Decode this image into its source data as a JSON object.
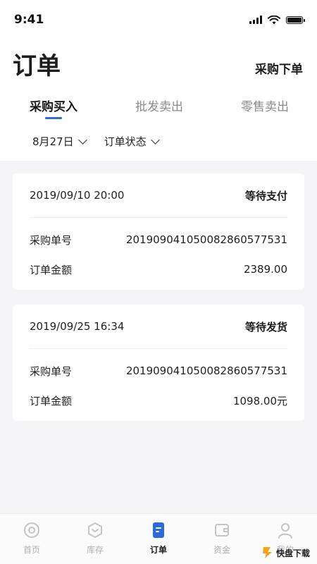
{
  "status_bar": {
    "time": "9:41"
  },
  "header": {
    "title": "订单",
    "action_label": "采购下单"
  },
  "tabs": [
    {
      "label": "采购买入",
      "active": true
    },
    {
      "label": "批发卖出",
      "active": false
    },
    {
      "label": "零售卖出",
      "active": false
    }
  ],
  "filters": {
    "date_label": "8月27日",
    "status_label": "订单状态"
  },
  "orders": [
    {
      "datetime": "2019/09/10 20:00",
      "status": "等待支付",
      "order_no_label": "采购单号",
      "order_no": "2019090410500828605775​31",
      "amount_label": "订单金额",
      "amount": "2389.00"
    },
    {
      "datetime": "2019/09/25 16:34",
      "status": "等待发货",
      "order_no_label": "采购单号",
      "order_no": "201909041050082860577531",
      "amount_label": "订单金额",
      "amount": "1098.00元"
    }
  ],
  "tabbar": [
    {
      "label": "首页",
      "icon": "home-icon",
      "active": false
    },
    {
      "label": "库存",
      "icon": "inventory-icon",
      "active": false
    },
    {
      "label": "订单",
      "icon": "order-icon",
      "active": true
    },
    {
      "label": "资金",
      "icon": "wallet-icon",
      "active": false
    },
    {
      "label": "我的",
      "icon": "user-icon",
      "active": false
    }
  ],
  "watermark": {
    "text": "快盘下载"
  },
  "colors": {
    "accent": "#2b6bdb",
    "background": "#f5f5f7"
  }
}
